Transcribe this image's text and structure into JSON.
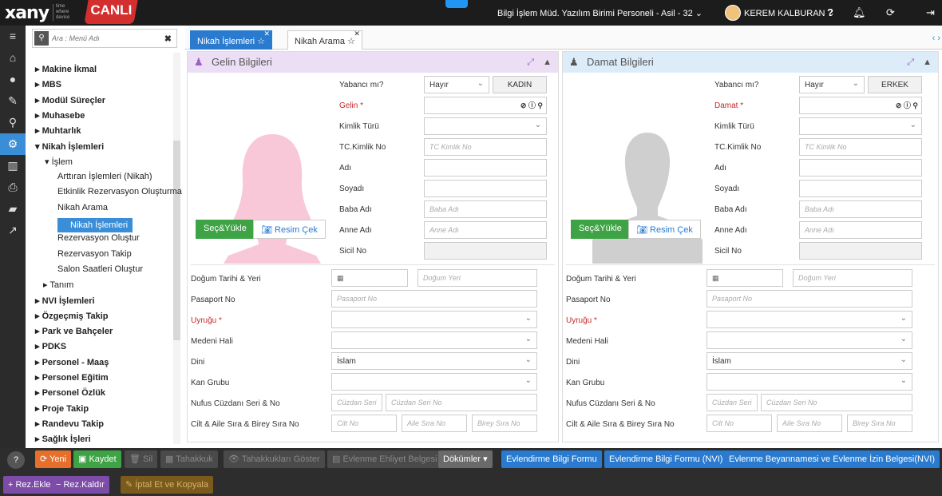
{
  "header": {
    "logo": "xany",
    "logo_sub": [
      "time",
      "where",
      "device"
    ],
    "env_badge": "CANLI",
    "context": "Bilgi İşlem Müd. Yazılım Birimi Personeli - Asil - 32 ⌄",
    "user": "KEREM KALBURAN ⌄",
    "icons": [
      "help-icon",
      "bell-icon",
      "refresh-icon",
      "logout-icon"
    ]
  },
  "leftnav": [
    "menu-icon",
    "home-icon",
    "circle-arrow-icon",
    "wrench-icon",
    "search-icon",
    "gear-icon",
    "map-icon",
    "print-icon",
    "folder-icon",
    "chart-icon"
  ],
  "search": {
    "placeholder": "Ara : Menü Adı"
  },
  "tree": {
    "items": [
      {
        "label": "▸ Makine İkmal",
        "bold": true
      },
      {
        "label": "▸ MBS",
        "bold": true
      },
      {
        "label": "▸ Modül Süreçler",
        "bold": true
      },
      {
        "label": "▸ Muhasebe",
        "bold": true
      },
      {
        "label": "▸ Muhtarlık",
        "bold": true
      },
      {
        "label": "▾ Nikah İşlemleri",
        "bold": true
      },
      {
        "label": "▾ İşlem",
        "bold": false
      },
      {
        "label": "Arttıran İşlemleri (Nikah)",
        "bold": false
      },
      {
        "label": "Etkinlik Rezervasyon Oluşturma",
        "bold": false
      },
      {
        "label": "Nikah Arama",
        "bold": false
      },
      {
        "label": "Nikah İşlemleri",
        "bold": false,
        "selected": true
      },
      {
        "label": "Rezervasyon Oluştur",
        "bold": false
      },
      {
        "label": "Rezervasyon Takip",
        "bold": false
      },
      {
        "label": "Salon Saatleri Oluştur",
        "bold": false
      },
      {
        "label": "▸ Tanım",
        "bold": false
      },
      {
        "label": "▸ NVI İşlemleri",
        "bold": true
      },
      {
        "label": "▸ Özgeçmiş Takip",
        "bold": true
      },
      {
        "label": "▸ Park ve Bahçeler",
        "bold": true
      },
      {
        "label": "▸ PDKS",
        "bold": true
      },
      {
        "label": "▸ Personel - Maaş",
        "bold": true
      },
      {
        "label": "▸ Personel Eğitim",
        "bold": true
      },
      {
        "label": "▸ Personel Özlük",
        "bold": true
      },
      {
        "label": "▸ Proje Takip",
        "bold": true
      },
      {
        "label": "▸ Randevu Takip",
        "bold": true
      },
      {
        "label": "▸ Sağlık İşleri",
        "bold": true
      }
    ]
  },
  "tabs": [
    {
      "label": "Nikah İşlemleri ☆",
      "active": true
    },
    {
      "label": "Nikah Arama ☆",
      "active": false
    }
  ],
  "bride": {
    "title": "Gelin Bilgileri",
    "upload": "Seç&Yükle",
    "camera": "Resim Çek",
    "foreigner_label": "Yabancı mı?",
    "foreigner_value": "Hayır",
    "gender": "KADIN",
    "person_label": "Gelin *",
    "idtype_label": "Kimlik Türü",
    "tc_label": "TC.Kimlik No",
    "tc_ph": "TC Kimlik No",
    "name_label": "Adı",
    "surname_label": "Soyadı",
    "father_label": "Baba Adı",
    "father_ph": "Baba Adı",
    "mother_label": "Anne Adı",
    "mother_ph": "Anne Adı",
    "sicil_label": "Sicil No",
    "birth_label": "Doğum Tarihi & Yeri",
    "birth_place_ph": "Doğum Yeri",
    "passport_label": "Pasaport No",
    "passport_ph": "Pasaport No",
    "nation_label": "Uyruğu *",
    "marital_label": "Medeni Hali",
    "religion_label": "Dini",
    "religion_value": "İslam",
    "blood_label": "Kan Grubu",
    "idcard_label": "Nufus Cüzdanı Seri & No",
    "idcard_seri_ph": "Cüzdan Seri",
    "idcard_no_ph": "Cüzdan Seri No",
    "family_label": "Cilt & Aile Sıra & Birey Sıra No",
    "cilt_ph": "Cilt No",
    "aile_ph": "Aile Sıra No",
    "birey_ph": "Birey Sıra No"
  },
  "groom": {
    "title": "Damat Bilgileri",
    "upload": "Seç&Yükle",
    "camera": "Resim Çek",
    "foreigner_label": "Yabancı mı?",
    "foreigner_value": "Hayır",
    "gender": "ERKEK",
    "person_label": "Damat *",
    "idtype_label": "Kimlik Türü",
    "tc_label": "TC.Kimlik No",
    "tc_ph": "TC Kimlik No",
    "name_label": "Adı",
    "surname_label": "Soyadı",
    "father_label": "Baba Adı",
    "father_ph": "Baba Adı",
    "mother_label": "Anne Adı",
    "mother_ph": "Anne Adı",
    "sicil_label": "Sicil No",
    "birth_label": "Doğum Tarihi & Yeri",
    "birth_place_ph": "Doğum Yeri",
    "passport_label": "Pasaport No",
    "passport_ph": "Pasaport No",
    "nation_label": "Uyruğu *",
    "marital_label": "Medeni Hali",
    "religion_label": "Dini",
    "religion_value": "İslam",
    "blood_label": "Kan Grubu",
    "idcard_label": "Nufus Cüzdanı Seri & No",
    "idcard_seri_ph": "Cüzdan Seri",
    "idcard_no_ph": "Cüzdan Seri No",
    "family_label": "Cilt & Aile Sıra & Birey Sıra No",
    "cilt_ph": "Cilt No",
    "aile_ph": "Aile Sıra No",
    "birey_ph": "Birey Sıra No"
  },
  "toolbar": {
    "help": "?",
    "new": "⟳ Yeni",
    "save": "▣ Kaydet",
    "delete": "🗑 Sil",
    "accrual": "▦ Tahakkuk",
    "show_accruals": "👁 Tahakkukları Göster",
    "license_doc": "▤ Evlenme Ehliyet Belgesi",
    "documents": "Dökümler ▾",
    "form": "Evlendirme Bilgi Formu",
    "form_nvi": "Evlendirme Bilgi Formu (NVI)",
    "declaration": "Evlenme Beyannamesi ve Evlenme İzin Belgesi(NVI)",
    "add_res": "+ Rez.Ekle",
    "remove_res": "− Rez.Kaldır",
    "cancel_copy": "✎ İptal Et ve Kopyala"
  },
  "colors": {
    "bride_header": "#ecdff5",
    "groom_header": "#dcecf9",
    "accent": "#2a7bd0",
    "required": "#c62828"
  }
}
